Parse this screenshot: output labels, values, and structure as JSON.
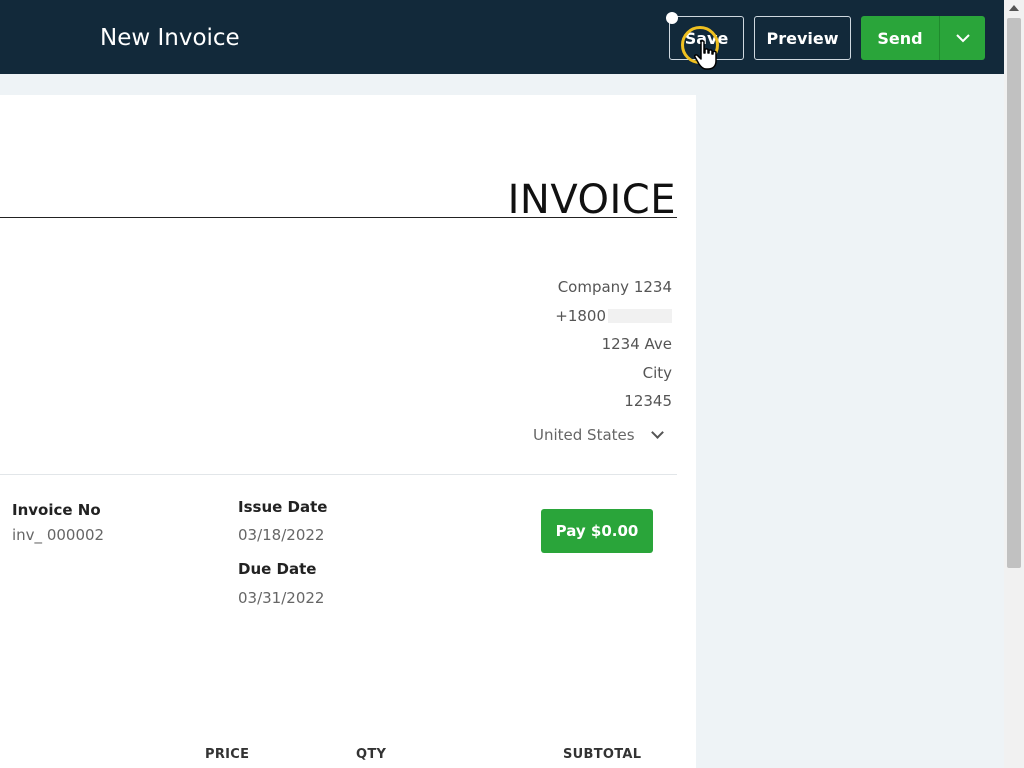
{
  "header": {
    "title": "New Invoice",
    "save_label": "Save",
    "preview_label": "Preview",
    "send_label": "Send"
  },
  "invoice": {
    "heading": "INVOICE",
    "company": {
      "name": "Company 1234",
      "phone": "+1800",
      "street": "1234 Ave",
      "city": "City",
      "zip": "12345",
      "country": "United States"
    },
    "invoice_no_label": "Invoice No",
    "invoice_no_value": "inv_  000002",
    "issue_date_label": "Issue Date",
    "issue_date_value": "03/18/2022",
    "due_date_label": "Due Date",
    "due_date_value": "03/31/2022",
    "pay_button_label": "Pay $0.00",
    "columns": [
      "PRICE",
      "QTY",
      "SUBTOTAL"
    ]
  },
  "colors": {
    "header_bg": "#12293a",
    "accent_green": "#2aa53a",
    "page_bg": "#eef3f6"
  }
}
